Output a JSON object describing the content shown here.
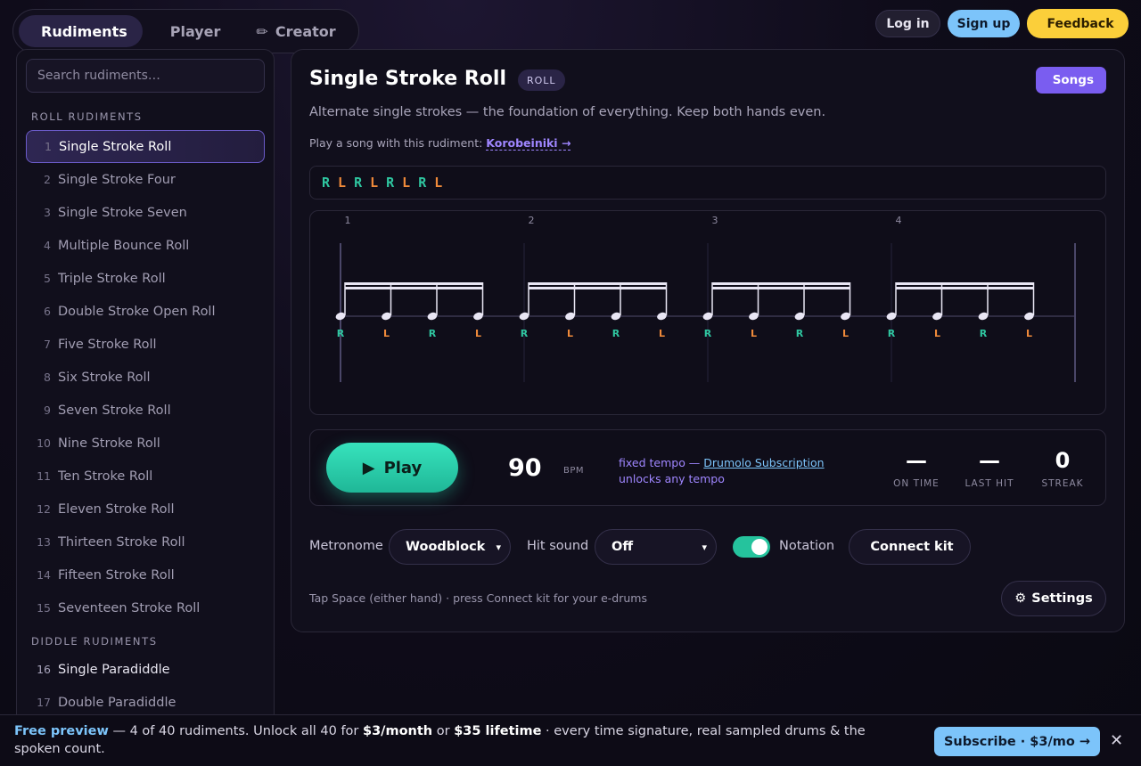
{
  "nav": {
    "tabs": [
      {
        "icon": "",
        "label": "Rudiments",
        "active": true
      },
      {
        "icon": "",
        "label": "Player",
        "active": false
      },
      {
        "icon": "✏",
        "label": "Creator",
        "active": false
      }
    ],
    "login_label": "Log in",
    "signup_label": "Sign up",
    "feedback_icon": "",
    "feedback_label": "Feedback"
  },
  "sidebar": {
    "search_placeholder": "Search rudiments…",
    "sections": [
      {
        "label": "ROLL RUDIMENTS",
        "items": [
          {
            "num": "1",
            "name": "Single Stroke Roll",
            "locked": false,
            "active": true
          },
          {
            "num": "2",
            "name": "Single Stroke Four",
            "locked": true
          },
          {
            "num": "3",
            "name": "Single Stroke Seven",
            "locked": true
          },
          {
            "num": "4",
            "name": "Multiple Bounce Roll",
            "locked": true
          },
          {
            "num": "5",
            "name": "Triple Stroke Roll",
            "locked": true
          },
          {
            "num": "6",
            "name": "Double Stroke Open Roll",
            "locked": true
          },
          {
            "num": "7",
            "name": "Five Stroke Roll",
            "locked": true
          },
          {
            "num": "8",
            "name": "Six Stroke Roll",
            "locked": true
          },
          {
            "num": "9",
            "name": "Seven Stroke Roll",
            "locked": true
          },
          {
            "num": "10",
            "name": "Nine Stroke Roll",
            "locked": true
          },
          {
            "num": "11",
            "name": "Ten Stroke Roll",
            "locked": true
          },
          {
            "num": "12",
            "name": "Eleven Stroke Roll",
            "locked": true
          },
          {
            "num": "13",
            "name": "Thirteen Stroke Roll",
            "locked": true
          },
          {
            "num": "14",
            "name": "Fifteen Stroke Roll",
            "locked": true
          },
          {
            "num": "15",
            "name": "Seventeen Stroke Roll",
            "locked": true
          }
        ]
      },
      {
        "label": "DIDDLE RUDIMENTS",
        "items": [
          {
            "num": "16",
            "name": "Single Paradiddle",
            "locked": false
          },
          {
            "num": "17",
            "name": "Double Paradiddle",
            "locked": true
          }
        ]
      }
    ],
    "lock_icon": ""
  },
  "rudiment": {
    "title": "Single Stroke Roll",
    "badge": "ROLL",
    "songs_icon": "",
    "songs_label": "Songs",
    "description": "Alternate single strokes — the foundation of everything. Keep both hands even.",
    "song_hint_icon": "",
    "song_hint_text": "Play a song with this rudiment:",
    "song_link": "Korobeiniki →",
    "sticking": [
      "R",
      "L",
      "R",
      "L",
      "R",
      "L",
      "R",
      "L"
    ]
  },
  "notation": {
    "beat_labels": [
      "1",
      "2",
      "3",
      "4"
    ],
    "hands": [
      "R",
      "L",
      "R",
      "L",
      "R",
      "L",
      "R",
      "L",
      "R",
      "L",
      "R",
      "L",
      "R",
      "L",
      "R",
      "L"
    ],
    "colors": {
      "R": "#2fc7a1",
      "L": "#f08a3a",
      "note": "#e9e6f4",
      "line": "#3a3650"
    }
  },
  "transport": {
    "play_icon": "▶",
    "play_label": "Play",
    "tempo_dec_icon": "",
    "tempo_value": "90",
    "tempo_unit": "BPM",
    "tempo_inc_icon": "",
    "tempo_note_icon": "",
    "tempo_note_text": "fixed tempo —",
    "tempo_note_link": "Drumolo Subscription",
    "tempo_note_tail": "unlocks any tempo",
    "stats": [
      {
        "value": "—",
        "label": "ON TIME"
      },
      {
        "value": "—",
        "label": "LAST HIT"
      },
      {
        "value": "0",
        "label": "STREAK"
      }
    ]
  },
  "controls": {
    "metronome_label": "Metronome",
    "metronome_value": "Woodblock",
    "hit_sound_label": "Hit sound",
    "hit_sound_value": "Off",
    "notation_label": "Notation",
    "notation_on": true,
    "connect_icon": "",
    "connect_label": "Connect kit",
    "hint_pre": "Tap Space (either hand) · press",
    "hint_icon": "",
    "hint_post": "Connect kit for your e-drums",
    "settings_icon": "⚙",
    "settings_label": "Settings"
  },
  "banner": {
    "free_preview": "Free preview",
    "text_1": " — 4 of 40 rudiments. Unlock all 40 for ",
    "price_month": "$3/month",
    "text_2": " or ",
    "price_lifetime": "$35 lifetime",
    "text_3": " · every time signature, real sampled drums & the spoken count.",
    "subscribe_label": "Subscribe · $3/mo →",
    "close_icon": "✕"
  }
}
